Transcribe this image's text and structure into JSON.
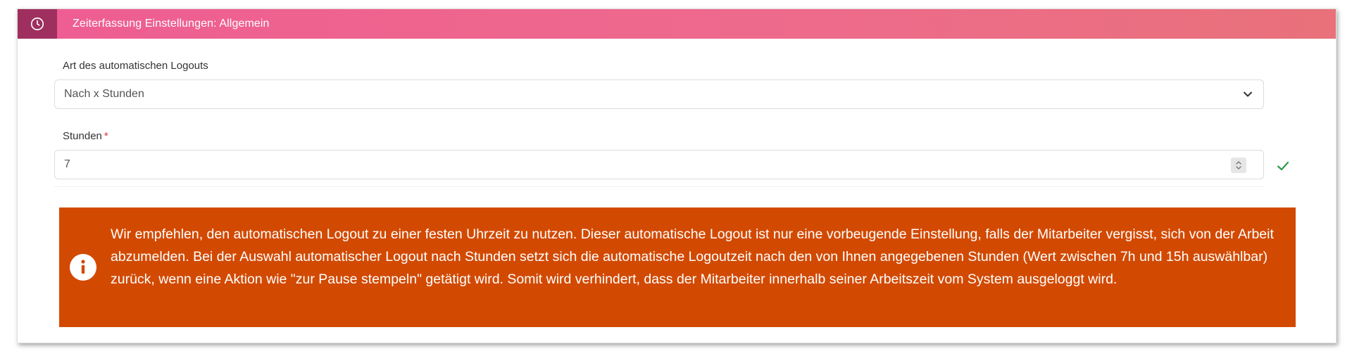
{
  "header": {
    "title": "Zeiterfassung Einstellungen: Allgemein",
    "icon": "clock-icon",
    "color_start": "#ee5d92",
    "color_end": "#e8717a",
    "icon_bg": "#9e2f5f"
  },
  "logout_type": {
    "label": "Art des automatischen Logouts",
    "value": "Nach x Stunden"
  },
  "hours": {
    "label": "Stunden",
    "required_mark": "*",
    "value": "7",
    "valid": true
  },
  "alert": {
    "icon": "info-icon",
    "color": "#d24a02",
    "text": "Wir empfehlen, den automatischen Logout zu einer festen Uhrzeit zu nutzen. Dieser automatische Logout ist nur eine vorbeugende Einstellung, falls der Mitarbeiter vergisst, sich von der Arbeit abzumelden. Bei der Auswahl automatischer Logout nach Stunden setzt sich die automatische Logoutzeit nach den von Ihnen angegebenen Stunden (Wert zwischen 7h und 15h auswählbar) zurück, wenn eine Aktion wie \"zur Pause stempeln\" getätigt wird. Somit wird verhindert, dass der Mitarbeiter innerhalb seiner Arbeitszeit vom System ausgeloggt wird."
  }
}
